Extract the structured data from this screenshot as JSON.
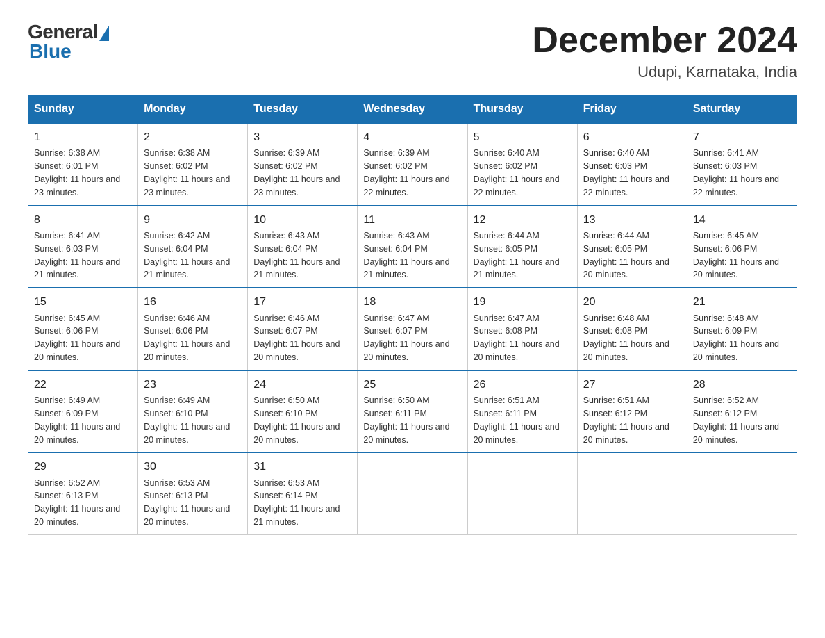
{
  "header": {
    "logo_general": "General",
    "logo_blue": "Blue",
    "title": "December 2024",
    "location": "Udupi, Karnataka, India"
  },
  "days_of_week": [
    "Sunday",
    "Monday",
    "Tuesday",
    "Wednesday",
    "Thursday",
    "Friday",
    "Saturday"
  ],
  "weeks": [
    [
      {
        "day": "1",
        "sunrise": "6:38 AM",
        "sunset": "6:01 PM",
        "daylight": "11 hours and 23 minutes."
      },
      {
        "day": "2",
        "sunrise": "6:38 AM",
        "sunset": "6:02 PM",
        "daylight": "11 hours and 23 minutes."
      },
      {
        "day": "3",
        "sunrise": "6:39 AM",
        "sunset": "6:02 PM",
        "daylight": "11 hours and 23 minutes."
      },
      {
        "day": "4",
        "sunrise": "6:39 AM",
        "sunset": "6:02 PM",
        "daylight": "11 hours and 22 minutes."
      },
      {
        "day": "5",
        "sunrise": "6:40 AM",
        "sunset": "6:02 PM",
        "daylight": "11 hours and 22 minutes."
      },
      {
        "day": "6",
        "sunrise": "6:40 AM",
        "sunset": "6:03 PM",
        "daylight": "11 hours and 22 minutes."
      },
      {
        "day": "7",
        "sunrise": "6:41 AM",
        "sunset": "6:03 PM",
        "daylight": "11 hours and 22 minutes."
      }
    ],
    [
      {
        "day": "8",
        "sunrise": "6:41 AM",
        "sunset": "6:03 PM",
        "daylight": "11 hours and 21 minutes."
      },
      {
        "day": "9",
        "sunrise": "6:42 AM",
        "sunset": "6:04 PM",
        "daylight": "11 hours and 21 minutes."
      },
      {
        "day": "10",
        "sunrise": "6:43 AM",
        "sunset": "6:04 PM",
        "daylight": "11 hours and 21 minutes."
      },
      {
        "day": "11",
        "sunrise": "6:43 AM",
        "sunset": "6:04 PM",
        "daylight": "11 hours and 21 minutes."
      },
      {
        "day": "12",
        "sunrise": "6:44 AM",
        "sunset": "6:05 PM",
        "daylight": "11 hours and 21 minutes."
      },
      {
        "day": "13",
        "sunrise": "6:44 AM",
        "sunset": "6:05 PM",
        "daylight": "11 hours and 20 minutes."
      },
      {
        "day": "14",
        "sunrise": "6:45 AM",
        "sunset": "6:06 PM",
        "daylight": "11 hours and 20 minutes."
      }
    ],
    [
      {
        "day": "15",
        "sunrise": "6:45 AM",
        "sunset": "6:06 PM",
        "daylight": "11 hours and 20 minutes."
      },
      {
        "day": "16",
        "sunrise": "6:46 AM",
        "sunset": "6:06 PM",
        "daylight": "11 hours and 20 minutes."
      },
      {
        "day": "17",
        "sunrise": "6:46 AM",
        "sunset": "6:07 PM",
        "daylight": "11 hours and 20 minutes."
      },
      {
        "day": "18",
        "sunrise": "6:47 AM",
        "sunset": "6:07 PM",
        "daylight": "11 hours and 20 minutes."
      },
      {
        "day": "19",
        "sunrise": "6:47 AM",
        "sunset": "6:08 PM",
        "daylight": "11 hours and 20 minutes."
      },
      {
        "day": "20",
        "sunrise": "6:48 AM",
        "sunset": "6:08 PM",
        "daylight": "11 hours and 20 minutes."
      },
      {
        "day": "21",
        "sunrise": "6:48 AM",
        "sunset": "6:09 PM",
        "daylight": "11 hours and 20 minutes."
      }
    ],
    [
      {
        "day": "22",
        "sunrise": "6:49 AM",
        "sunset": "6:09 PM",
        "daylight": "11 hours and 20 minutes."
      },
      {
        "day": "23",
        "sunrise": "6:49 AM",
        "sunset": "6:10 PM",
        "daylight": "11 hours and 20 minutes."
      },
      {
        "day": "24",
        "sunrise": "6:50 AM",
        "sunset": "6:10 PM",
        "daylight": "11 hours and 20 minutes."
      },
      {
        "day": "25",
        "sunrise": "6:50 AM",
        "sunset": "6:11 PM",
        "daylight": "11 hours and 20 minutes."
      },
      {
        "day": "26",
        "sunrise": "6:51 AM",
        "sunset": "6:11 PM",
        "daylight": "11 hours and 20 minutes."
      },
      {
        "day": "27",
        "sunrise": "6:51 AM",
        "sunset": "6:12 PM",
        "daylight": "11 hours and 20 minutes."
      },
      {
        "day": "28",
        "sunrise": "6:52 AM",
        "sunset": "6:12 PM",
        "daylight": "11 hours and 20 minutes."
      }
    ],
    [
      {
        "day": "29",
        "sunrise": "6:52 AM",
        "sunset": "6:13 PM",
        "daylight": "11 hours and 20 minutes."
      },
      {
        "day": "30",
        "sunrise": "6:53 AM",
        "sunset": "6:13 PM",
        "daylight": "11 hours and 20 minutes."
      },
      {
        "day": "31",
        "sunrise": "6:53 AM",
        "sunset": "6:14 PM",
        "daylight": "11 hours and 21 minutes."
      },
      null,
      null,
      null,
      null
    ]
  ]
}
